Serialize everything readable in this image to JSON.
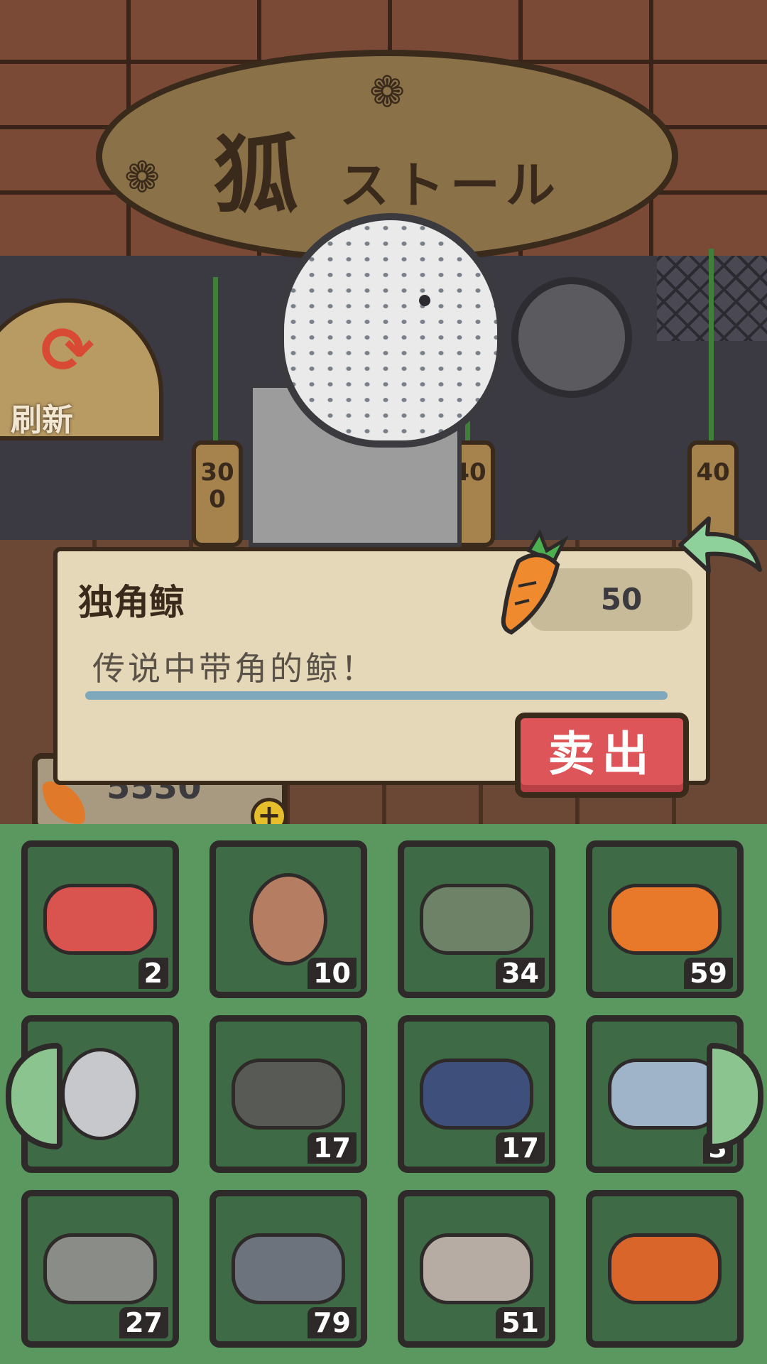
{
  "shop": {
    "sign_title": "狐",
    "sign_subtitle": "ストール",
    "refresh_label": "刷新",
    "price_tags": [
      "300",
      "40",
      "40"
    ]
  },
  "wallet": {
    "coins": "5530"
  },
  "dialog": {
    "item_name": "独角鲸",
    "price": "50",
    "description": "传说中带角的鲸！",
    "sell_label": "卖出"
  },
  "inventory": {
    "items": [
      {
        "name": "instant-noodles",
        "qty": "2",
        "color": "#d9534f"
      },
      {
        "name": "egg",
        "qty": "10",
        "color": "#b57e62"
      },
      {
        "name": "message-bottle",
        "qty": "34",
        "color": "#6d8266"
      },
      {
        "name": "clownfish",
        "qty": "59",
        "color": "#e8792b"
      },
      {
        "name": "narwhal",
        "qty": "",
        "color": "#c7c8cc"
      },
      {
        "name": "catfish",
        "qty": "17",
        "color": "#575a55"
      },
      {
        "name": "swordfish",
        "qty": "17",
        "color": "#3d4f7a"
      },
      {
        "name": "discus-fish",
        "qty": "3",
        "color": "#9fb3c9"
      },
      {
        "name": "sturgeon",
        "qty": "27",
        "color": "#8a8d87"
      },
      {
        "name": "tuna",
        "qty": "79",
        "color": "#6d737c"
      },
      {
        "name": "fish-bone",
        "qty": "51",
        "color": "#b7aca4"
      },
      {
        "name": "arowana",
        "qty": "",
        "color": "#d9652a"
      }
    ]
  }
}
